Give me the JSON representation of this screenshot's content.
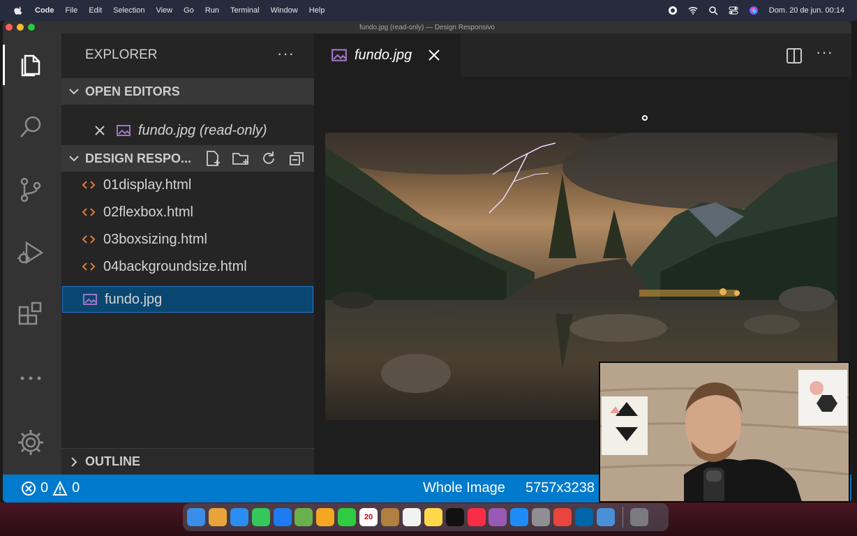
{
  "menubar": {
    "app_name": "Code",
    "menus": [
      "File",
      "Edit",
      "Selection",
      "View",
      "Go",
      "Run",
      "Terminal",
      "Window",
      "Help"
    ],
    "clock": "Dom. 20 de jun.  00:14"
  },
  "window": {
    "title": "fundo.jpg (read-only) — Design Responsivo"
  },
  "sidebar": {
    "title": "EXPLORER",
    "more": "···",
    "open_editors": {
      "label": "OPEN EDITORS",
      "items": [
        {
          "label": "fundo.jpg (read-only)"
        }
      ]
    },
    "project": {
      "label": "DESIGN RESPO...",
      "files": [
        {
          "name": "01display.html",
          "icon": "html-icon"
        },
        {
          "name": "02flexbox.html",
          "icon": "html-icon"
        },
        {
          "name": "03boxsizing.html",
          "icon": "html-icon"
        },
        {
          "name": "04backgroundsize.html",
          "icon": "html-icon"
        },
        {
          "name": "fundo.jpg",
          "icon": "image-file-icon",
          "selected": true
        }
      ]
    },
    "outline": {
      "label": "OUTLINE"
    }
  },
  "editor": {
    "tab": {
      "label": "fundo.jpg"
    },
    "more": "···"
  },
  "statusbar": {
    "errors": "0",
    "warnings": "0",
    "zoom": "Whole Image",
    "dimensions": "5757x3238"
  },
  "colors": {
    "statusbar": "#007acc",
    "selection": "#094771",
    "sidebar": "#252526",
    "editor": "#1e1e1e",
    "activitybar": "#333333"
  },
  "dock": {
    "calendar_day": "20"
  }
}
